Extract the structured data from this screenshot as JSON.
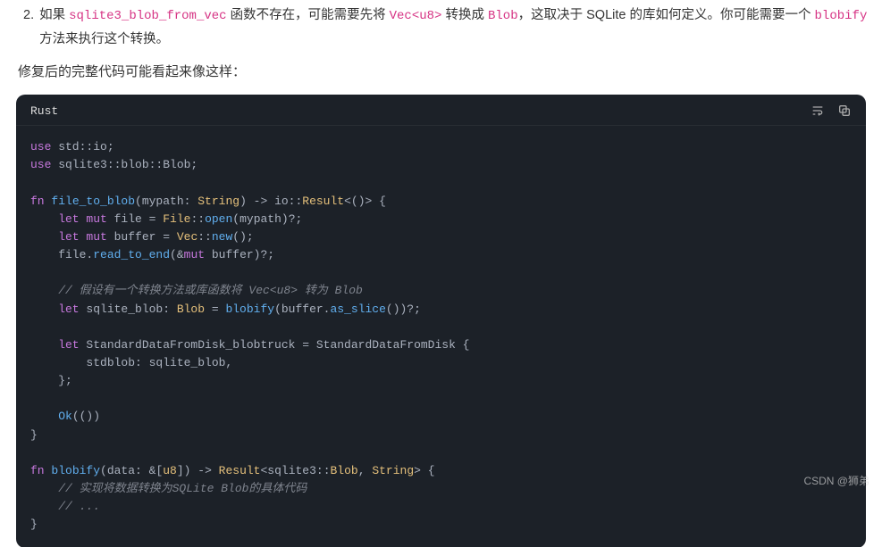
{
  "list": {
    "num": "2.",
    "parts": {
      "t1": "如果 ",
      "c1": "sqlite3_blob_from_vec",
      "t2": " 函数不存在，可能需要先将 ",
      "c2": "Vec<u8>",
      "t3": " 转换成 ",
      "c3": "Blob",
      "t4": "，这取决于 SQLite 的库如何定义。你可能需要一个 ",
      "c4": "blobify",
      "t5": " 方法来执行这个转换。"
    }
  },
  "para": "修复后的完整代码可能看起来像这样：",
  "code": {
    "lang": "Rust",
    "lines": {
      "l1_use": "use",
      "l1_path": " std::io;",
      "l2_use": "use",
      "l2_path": " sqlite3::blob::Blob;",
      "blank1": "",
      "l3_fn": "fn",
      "l3_name": " file_to_blob",
      "l3_sig1": "(mypath: ",
      "l3_type": "String",
      "l3_sig2": ") -> io::",
      "l3_res": "Result",
      "l3_sig3": "<()> {",
      "l4_let": "    let",
      "l4_mut": " mut",
      "l4_rest1": " file = ",
      "l4_type": "File",
      "l4_rest2": "::",
      "l4_fn": "open",
      "l4_rest3": "(mypath)?;",
      "l5_let": "    let",
      "l5_mut": " mut",
      "l5_rest1": " buffer = ",
      "l5_type": "Vec",
      "l5_rest2": "::",
      "l5_fn": "new",
      "l5_rest3": "();",
      "l6_pre": "    file.",
      "l6_fn": "read_to_end",
      "l6_rest": "(&",
      "l6_mut": "mut",
      "l6_rest2": " buffer)?;",
      "blank2": "",
      "l7_comm": "    // 假设有一个转换方法或库函数将 Vec<u8> 转为 Blob",
      "l8_let": "    let",
      "l8_rest1": " sqlite_blob: ",
      "l8_type": "Blob",
      "l8_rest2": " = ",
      "l8_fn": "blobify",
      "l8_rest3": "(buffer.",
      "l8_fn2": "as_slice",
      "l8_rest4": "())?;",
      "blank3": "",
      "l9_let": "    let",
      "l9_rest1": " StandardDataFromDisk_blobtruck = StandardDataFromDisk {",
      "l10": "        stdblob: sqlite_blob,",
      "l11": "    };",
      "blank4": "",
      "l12_ok": "    Ok",
      "l12_rest": "(())",
      "l13": "}",
      "blank5": "",
      "l14_fn": "fn",
      "l14_name": " blobify",
      "l14_sig1": "(data: &[",
      "l14_u8": "u8",
      "l14_sig2": "]) -> ",
      "l14_res": "Result",
      "l14_sig3": "<sqlite3::",
      "l14_blob": "Blob",
      "l14_sig4": ", ",
      "l14_str": "String",
      "l14_sig5": "> {",
      "l15_comm": "    // 实现将数据转换为SQLite Blob的具体代码",
      "l16_comm": "    // ...",
      "l17": "}"
    }
  },
  "watermark": "CSDN @狮弟"
}
